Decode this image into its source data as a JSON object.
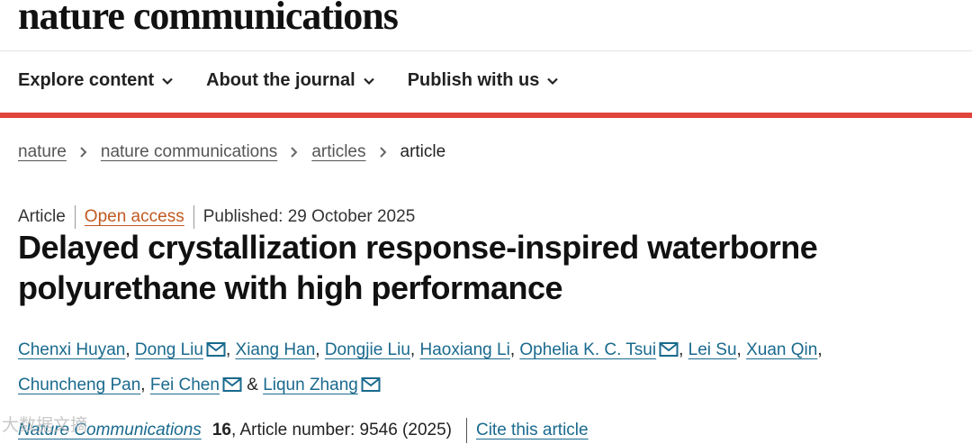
{
  "site": {
    "logo": "nature communications"
  },
  "nav": {
    "items": [
      {
        "label": "Explore content"
      },
      {
        "label": "About the journal"
      },
      {
        "label": "Publish with us"
      }
    ]
  },
  "breadcrumb": {
    "items": [
      "nature",
      "nature communications",
      "articles"
    ],
    "current": "article"
  },
  "meta": {
    "type": "Article",
    "access": "Open access",
    "published": "Published: 29 October 2025"
  },
  "article": {
    "title": "Delayed crystallization response-inspired waterborne polyurethane with high performance"
  },
  "authors": [
    {
      "name": "Chenxi Huyan",
      "mail": false
    },
    {
      "name": "Dong Liu",
      "mail": true
    },
    {
      "name": "Xiang Han",
      "mail": false
    },
    {
      "name": "Dongjie Liu",
      "mail": false
    },
    {
      "name": "Haoxiang Li",
      "mail": false
    },
    {
      "name": "Ophelia K. C. Tsui",
      "mail": true
    },
    {
      "name": "Lei Su",
      "mail": false
    },
    {
      "name": "Xuan Qin",
      "mail": false
    },
    {
      "name": "Chuncheng Pan",
      "mail": false
    },
    {
      "name": "Fei Chen",
      "mail": true
    },
    {
      "name": "Liqun Zhang",
      "mail": true
    }
  ],
  "citation": {
    "journal": "Nature Communications",
    "volume": "16",
    "details": ", Article number: 9546 (2025)",
    "cite_label": "Cite this article"
  },
  "watermark": "大数据文摘"
}
